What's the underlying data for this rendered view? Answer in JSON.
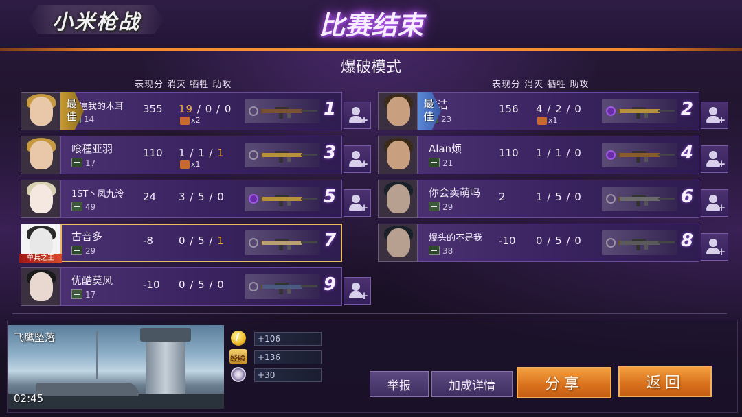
{
  "header": {
    "logo_text": "小米枪战",
    "title": "比赛结束",
    "accent_color": "#f28a2a"
  },
  "mode": "爆破模式",
  "columns": {
    "left": "表现分 消灭 牺牲 助攻",
    "right": "表现分 消灭 牺牲 助攻"
  },
  "best_label": "最佳",
  "left_team": [
    {
      "name": "你逼我的木耳",
      "rank_no": "14",
      "score": "355",
      "kills": "19",
      "deaths": "0",
      "assists": "0",
      "kills_gold": true,
      "assists_gold": false,
      "medal_count": "x2",
      "weapon_icon": "gear-icon",
      "rank_pos": "1",
      "best": true
    },
    {
      "name": "喰種亚羽",
      "rank_no": "17",
      "score": "110",
      "kills": "1",
      "deaths": "1",
      "assists": "1",
      "kills_gold": false,
      "assists_gold": true,
      "medal_count": "x1",
      "weapon_icon": "gear-icon",
      "rank_pos": "3",
      "best": false
    },
    {
      "name": "1ST丶凤九泠",
      "rank_no": "49",
      "score": "24",
      "kills": "3",
      "deaths": "5",
      "assists": "0",
      "kills_gold": false,
      "assists_gold": false,
      "medal_count": "",
      "weapon_icon": "purple-gem-icon",
      "rank_pos": "5",
      "best": false
    },
    {
      "name": "古音多",
      "rank_no": "29",
      "score": "-8",
      "kills": "0",
      "deaths": "5",
      "assists": "1",
      "kills_gold": false,
      "assists_gold": true,
      "medal_count": "",
      "weapon_icon": "gear-icon",
      "rank_pos": "7",
      "best": false,
      "avatar_tag": "单兵之王"
    },
    {
      "name": "优酷莫风",
      "rank_no": "17",
      "score": "-10",
      "kills": "0",
      "deaths": "5",
      "assists": "0",
      "kills_gold": false,
      "assists_gold": false,
      "medal_count": "",
      "weapon_icon": "gear-icon",
      "rank_pos": "9",
      "best": false
    }
  ],
  "right_team": [
    {
      "name": "铭洁",
      "rank_no": "23",
      "score": "156",
      "kills": "4",
      "deaths": "2",
      "assists": "0",
      "medal_count": "x1",
      "weapon_icon": "purple-gem-icon",
      "rank_pos": "2",
      "best": true
    },
    {
      "name": "Alan烦",
      "rank_no": "21",
      "score": "110",
      "kills": "1",
      "deaths": "1",
      "assists": "0",
      "medal_count": "",
      "weapon_icon": "purple-gem-icon",
      "rank_pos": "4",
      "best": false
    },
    {
      "name": "你会卖萌吗",
      "rank_no": "29",
      "score": "2",
      "kills": "1",
      "deaths": "5",
      "assists": "0",
      "medal_count": "",
      "weapon_icon": "gear-icon",
      "rank_pos": "6",
      "best": false
    },
    {
      "name": "爆头的不是我",
      "rank_no": "38",
      "score": "-10",
      "kills": "0",
      "deaths": "5",
      "assists": "0",
      "medal_count": "",
      "weapon_icon": "gear-icon",
      "rank_pos": "8",
      "best": false
    }
  ],
  "map": {
    "name": "飞鹰坠落",
    "time": "02:45"
  },
  "rewards": [
    {
      "icon": "gold-coin-icon",
      "value": "+106"
    },
    {
      "icon": "exp-badge-icon",
      "value": "+136",
      "icon_text": "经验"
    },
    {
      "icon": "honor-medal-icon",
      "value": "+30"
    }
  ],
  "buttons": {
    "report": "举报",
    "bonus_details": "加成详情",
    "share": "分享",
    "back": "返回"
  }
}
